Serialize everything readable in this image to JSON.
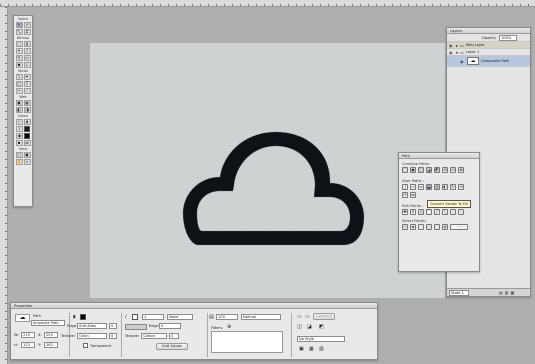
{
  "tools": {
    "title": "Tools",
    "sections": {
      "select": "Select",
      "bitmap": "Bitmap",
      "vector": "Vector",
      "web": "Web",
      "colors": "Colors",
      "view": "View"
    },
    "icons": [
      "pointer-icon",
      "subselect-icon",
      "scale-icon",
      "crop-icon",
      "marquee-icon",
      "lasso-icon",
      "magic-wand-icon",
      "brush-icon",
      "pencil-icon",
      "eraser-icon",
      "blur-icon",
      "rubber-stamp-icon",
      "line-icon",
      "pen-icon",
      "rectangle-icon",
      "text-icon",
      "freeform-icon",
      "knife-icon",
      "hotspot-icon",
      "slice-icon",
      "eyedropper-icon",
      "paint-bucket-icon",
      "hand-icon",
      "zoom-icon"
    ],
    "stroke_color": "#1a1a1a",
    "fill_color": "#000000"
  },
  "document": {
    "canvas_color": "#cfd2d3",
    "shape_fill": "#0e1115",
    "shape_name": "cloud-composite-path"
  },
  "layers": {
    "title": "Layers",
    "opacity_label": "Opacity",
    "opacity_value": "100%",
    "rows": [
      {
        "name": "Web Layer",
        "level": 0
      },
      {
        "name": "Layer 1",
        "level": 0
      },
      {
        "name": "Composite Path",
        "level": 1
      }
    ],
    "footer_state": "State 1"
  },
  "path_panel": {
    "title": "Path",
    "sections": [
      "Combine Paths :",
      "Alter Paths :",
      "Edit Points :",
      "Select Points :"
    ],
    "tooltip": "Convert Stroke To Fill"
  },
  "properties": {
    "title": "Properties",
    "object_type": "Path",
    "object_name": "omposite Path",
    "edge_label": "Edge:",
    "edge_value": "Anti-Alias",
    "edge_amount": "0",
    "texture_label": "Texture:",
    "texture_value": "Grain",
    "texture_amount": "0",
    "transparent_label": "Transparent",
    "stroke_size": "1",
    "stroke_type": "None",
    "edge2_label": "Edge:",
    "edge2_amount": "0",
    "texture2_label": "Texture:",
    "texture2_value": "Cotton",
    "texture2_amount": "0",
    "edit_stroke_label": "Edit Stroke",
    "opacity_value": "100",
    "blend_mode": "Normal",
    "filters_label": "Filters:",
    "combine_label": "Combine",
    "style_value": "No Style",
    "w_label": "W:",
    "w_value": "219",
    "x_label": "X:",
    "x_value": "255",
    "h_label": "H:",
    "h_value": "123",
    "y_label": "Y:",
    "y_value": "262"
  }
}
